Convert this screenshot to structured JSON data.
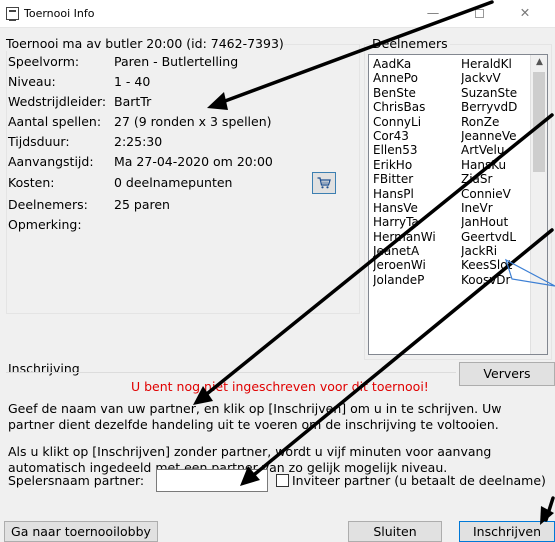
{
  "window": {
    "title": "Toernooi Info"
  },
  "info": {
    "heading": "Toernooi ma av butler 20:00 (id: 7462-7393)",
    "rows": [
      {
        "label": "Speelvorm:",
        "value": "Paren - Butlertelling"
      },
      {
        "label": "Niveau:",
        "value": "1 - 40"
      },
      {
        "label": "Wedstrijdleider:",
        "value": "BartTr"
      },
      {
        "label": "Aantal spellen:",
        "value": "27 (9 ronden x 3 spellen)"
      },
      {
        "label": "Tijdsduur:",
        "value": "2:25:30"
      },
      {
        "label": "Aanvangstijd:",
        "value": "Ma 27-04-2020 om 20:00"
      },
      {
        "label": "Kosten:",
        "value": "0 deelnamepunten"
      },
      {
        "label": "Deelnemers:",
        "value": "25 paren"
      },
      {
        "label": "Opmerking:",
        "value": ""
      }
    ]
  },
  "participants": {
    "title": "Deelnemers",
    "names": [
      "AadKa",
      "HeraldKl",
      "AnnePo",
      "JackvV",
      "BenSte",
      "SuzanSte",
      "ChrisBas",
      "BerryvdD",
      "ConnyLi",
      "RonZe",
      "Cor43",
      "JeanneVe",
      "Ellen53",
      "ArtVelu",
      "ErikHo",
      "HansKu",
      "FBitter",
      "ZiaSr",
      "HansPl",
      "ConnieV",
      "HansVe",
      "IneVr",
      "HarryTa",
      "JanHout",
      "HermanWi",
      "GeertvdL",
      "JeanetA",
      "JackRi",
      "JeroenWi",
      "KeesSlot",
      "JolandeP",
      "KoosvDr"
    ],
    "refresh_label": "Ververs"
  },
  "registration": {
    "title": "Inschrijving",
    "warning": "U bent nog niet ingeschreven voor dit toernooi!",
    "para1_line1": "Geef de naam van uw partner, en klik op [Inschrijven] om u in te schrijven. Uw",
    "para1_line2": "partner dient dezelfde handeling uit te voeren om de inschrijving te voltooien.",
    "para2_line1": "Als u klikt op [Inschrijven] zonder partner, wordt u vijf minuten voor aanvang",
    "para2_line2": "automatisch ingedeeld met een partner van zo gelijk mogelijk niveau.",
    "partner_label": "Spelersnaam partner:",
    "partner_value": "",
    "invite_label": "Inviteer partner (u betaalt de deelname)"
  },
  "buttons": {
    "lobby": "Ga naar toernooilobby",
    "close": "Sluiten",
    "register": "Inschrijven"
  },
  "icons": {
    "cart": "cart-icon",
    "arrow_color": "#000000"
  }
}
